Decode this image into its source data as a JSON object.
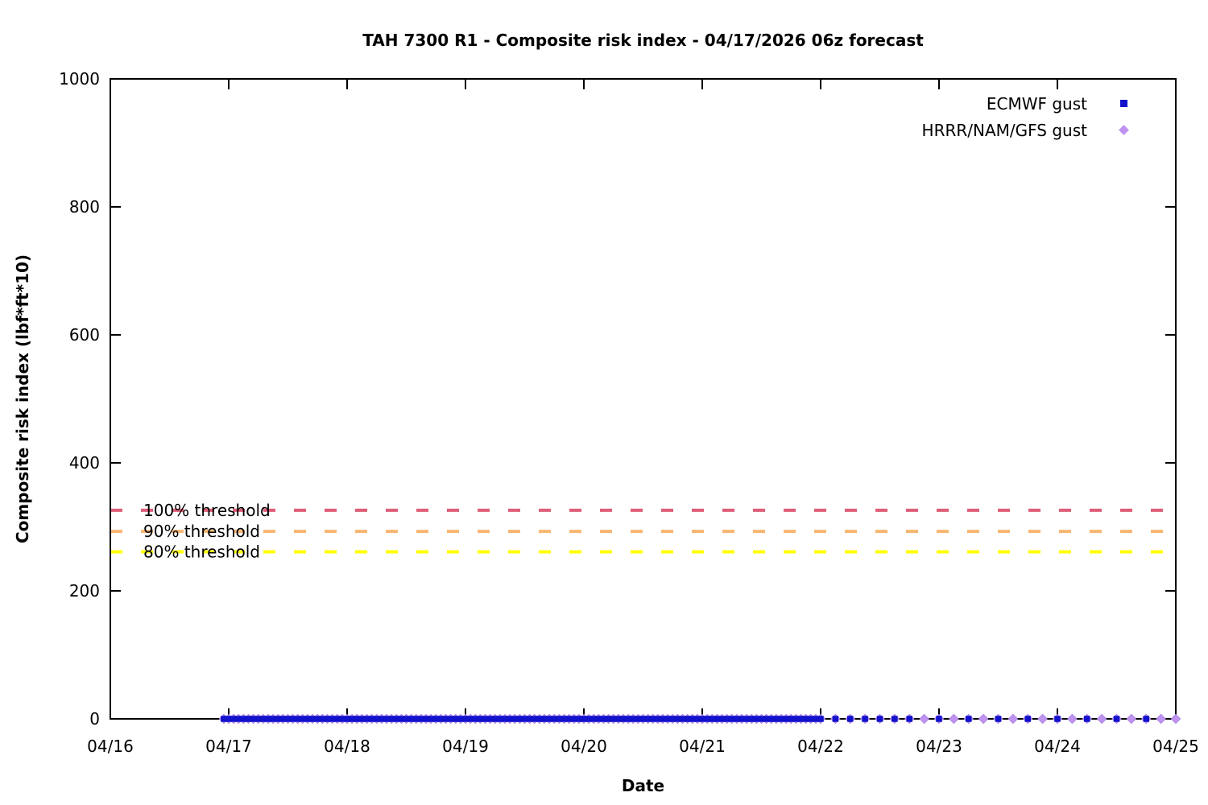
{
  "chart_data": {
    "type": "scatter",
    "title": "TAH 7300 R1 - Composite risk index - 04/17/2026 06z forecast",
    "xlabel": "Date",
    "ylabel": "Composite risk index (lbf*ft*10)",
    "grid": false,
    "x_axis": {
      "tick_labels": [
        "04/16",
        "04/17",
        "04/18",
        "04/19",
        "04/20",
        "04/21",
        "04/22",
        "04/23",
        "04/24",
        "04/25"
      ],
      "units": "days",
      "hours_span": 216
    },
    "y_axis": {
      "min": 0,
      "max": 1000,
      "ticks": [
        0,
        200,
        400,
        600,
        800,
        1000
      ]
    },
    "legend": {
      "position": "top-right"
    },
    "series": [
      {
        "name": "ECMWF gust",
        "marker": "square",
        "color": "#1212cc",
        "y_value": 0,
        "segments": [
          {
            "start_hour": 23,
            "end_hour": 144,
            "step_hours": 1
          },
          {
            "start_hour": 147,
            "end_hour": 162,
            "step_hours": 3
          },
          {
            "start_hour": 168,
            "end_hour": 168,
            "step_hours": 3
          },
          {
            "start_hour": 174,
            "end_hour": 210,
            "step_hours": 6
          }
        ]
      },
      {
        "name": "HRRR/NAM/GFS gust",
        "marker": "diamond",
        "color": "#bf93ef",
        "edge_color": "#a87fe2",
        "y_value": 0,
        "segments": [
          {
            "start_hour": 23,
            "end_hour": 144,
            "step_hours": 1
          },
          {
            "start_hour": 147,
            "end_hour": 216,
            "step_hours": 3
          }
        ]
      }
    ],
    "thresholds": [
      {
        "label": "100% threshold",
        "value": 326,
        "color": "#de5f78"
      },
      {
        "label": "90% threshold",
        "value": 293,
        "color": "#f8b672"
      },
      {
        "label": "80% threshold",
        "value": 261,
        "color": "#ffff00"
      }
    ]
  }
}
